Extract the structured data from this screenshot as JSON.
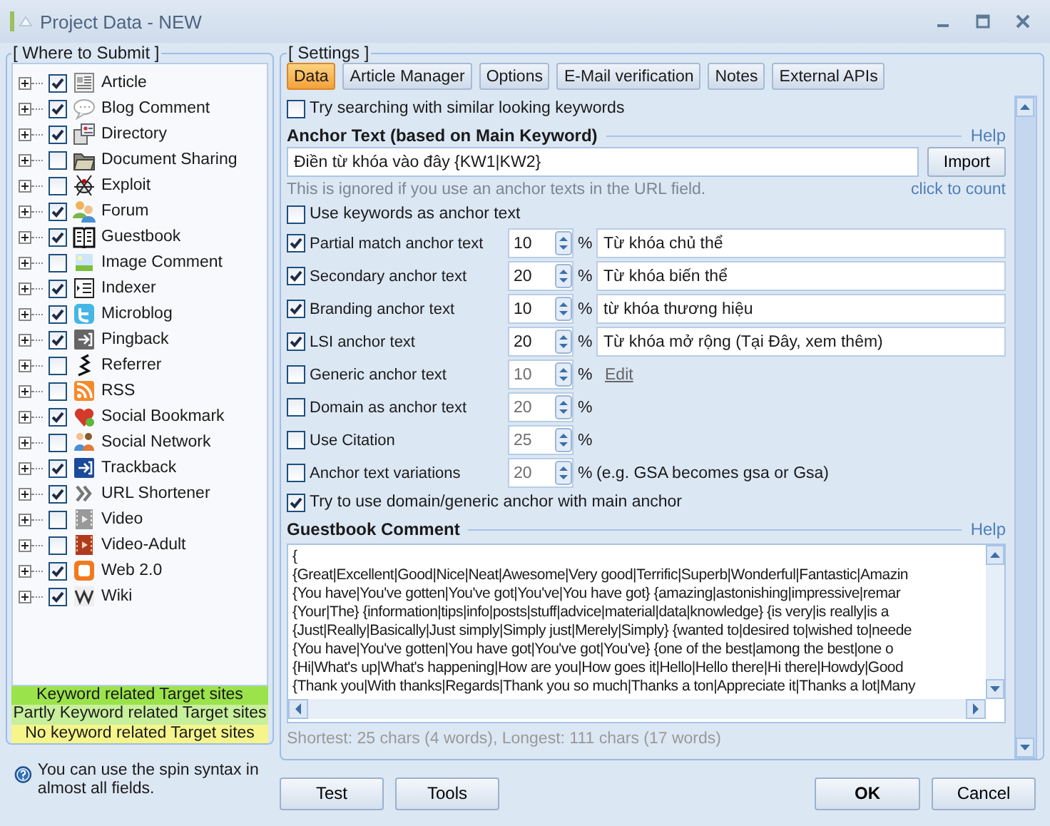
{
  "window": {
    "title": "Project Data - NEW"
  },
  "sidebar": {
    "title": "[ Where to Submit ]",
    "items": [
      {
        "label": "Article",
        "checked": true
      },
      {
        "label": "Blog Comment",
        "checked": true
      },
      {
        "label": "Directory",
        "checked": true
      },
      {
        "label": "Document Sharing",
        "checked": false
      },
      {
        "label": "Exploit",
        "checked": false
      },
      {
        "label": "Forum",
        "checked": true
      },
      {
        "label": "Guestbook",
        "checked": true
      },
      {
        "label": "Image Comment",
        "checked": false
      },
      {
        "label": "Indexer",
        "checked": true
      },
      {
        "label": "Microblog",
        "checked": true
      },
      {
        "label": "Pingback",
        "checked": true
      },
      {
        "label": "Referrer",
        "checked": false
      },
      {
        "label": "RSS",
        "checked": false
      },
      {
        "label": "Social Bookmark",
        "checked": true
      },
      {
        "label": "Social Network",
        "checked": false
      },
      {
        "label": "Trackback",
        "checked": true
      },
      {
        "label": "URL Shortener",
        "checked": true
      },
      {
        "label": "Video",
        "checked": false
      },
      {
        "label": "Video-Adult",
        "checked": false
      },
      {
        "label": "Web 2.0",
        "checked": true
      },
      {
        "label": "Wiki",
        "checked": true
      }
    ],
    "legend": [
      {
        "label": "Keyword related Target sites",
        "color": "#9be34b"
      },
      {
        "label": "Partly Keyword related Target sites",
        "color": "#c8ef9c"
      },
      {
        "label": "No keyword related Target sites",
        "color": "#f5f58c"
      }
    ],
    "hint": "You can use the spin syntax in almost all fields."
  },
  "settings": {
    "title": "[ Settings ]",
    "tabs": [
      {
        "label": "Data",
        "selected": true
      },
      {
        "label": "Article Manager",
        "selected": false
      },
      {
        "label": "Options",
        "selected": false
      },
      {
        "label": "E-Mail verification",
        "selected": false
      },
      {
        "label": "Notes",
        "selected": false
      },
      {
        "label": "External APIs",
        "selected": false
      }
    ],
    "similar_keywords": {
      "label": "Try searching with similar looking keywords",
      "checked": false
    },
    "anchor_text": {
      "heading": "Anchor Text (based on Main Keyword)",
      "help": "Help",
      "value": "Điền từ khóa vào đây {KW1|KW2}",
      "import_button": "Import",
      "hint": "This is ignored if you use an anchor texts in the URL field.",
      "count_link": "click to count"
    },
    "use_keywords": {
      "label": "Use keywords as anchor text",
      "checked": false
    },
    "anchor_rows": [
      {
        "kind": "field",
        "label": "Partial match anchor text",
        "checked": true,
        "value": "10",
        "unit": "%",
        "text": "Từ khóa chủ thể"
      },
      {
        "kind": "field",
        "label": "Secondary anchor text",
        "checked": true,
        "value": "20",
        "unit": "%",
        "text": "Từ khóa biến thể"
      },
      {
        "kind": "field",
        "label": "Branding anchor text",
        "checked": true,
        "value": "10",
        "unit": "%",
        "text": "từ khóa thương hiệu"
      },
      {
        "kind": "field",
        "label": "LSI anchor text",
        "checked": true,
        "value": "20",
        "unit": "%",
        "text": "Từ khóa mở rộng (Tại Đây, xem thêm)"
      },
      {
        "kind": "link",
        "label": "Generic anchor text",
        "checked": false,
        "value": "10",
        "unit": "%",
        "text": "Edit"
      },
      {
        "kind": "plain",
        "label": "Domain as anchor text",
        "checked": false,
        "value": "20",
        "unit": "%"
      },
      {
        "kind": "plain",
        "label": "Use Citation",
        "checked": false,
        "value": "25",
        "unit": "%"
      },
      {
        "kind": "note",
        "label": "Anchor text variations",
        "checked": false,
        "value": "20",
        "unit": "%",
        "text": "(e.g. GSA becomes gsa or Gsa)"
      }
    ],
    "domain_with_main": {
      "label": "Try to use domain/generic anchor with main anchor",
      "checked": true
    },
    "comment": {
      "heading": "Guestbook Comment",
      "help": "Help",
      "lines": [
        "{",
        "{Great|Excellent|Good|Nice|Neat|Awesome|Very good|Terrific|Superb|Wonderful|Fantastic|Amazin",
        "{You have|You've gotten|You've got|You've|You have got} {amazing|astonishing|impressive|remar",
        "{Your|The} {information|tips|info|posts|stuff|advice|material|data|knowledge} {is very|is really|is a",
        "{Just|Really|Basically|Just simply|Simply just|Merely|Simply} {wanted to|desired to|wished to|neede",
        "{You have|You've gotten|You have got|You've got|You've} {one of the best|among the best|one o",
        "{Hi|What's up|What's happening|How are you|How goes it|Hello|Hello there|Hi there|Howdy|Good",
        "{Thank you|With thanks|Regards|Thank you so much|Thanks a ton|Appreciate it|Thanks a lot|Many"
      ],
      "stats": "Shortest: 25 chars (4 words), Longest: 111 chars (17 words)"
    }
  },
  "buttons": [
    {
      "label": "Test",
      "kind": "left"
    },
    {
      "label": "Tools",
      "kind": "left"
    },
    {
      "label": "OK",
      "kind": "default"
    },
    {
      "label": "Cancel",
      "kind": "right"
    }
  ]
}
